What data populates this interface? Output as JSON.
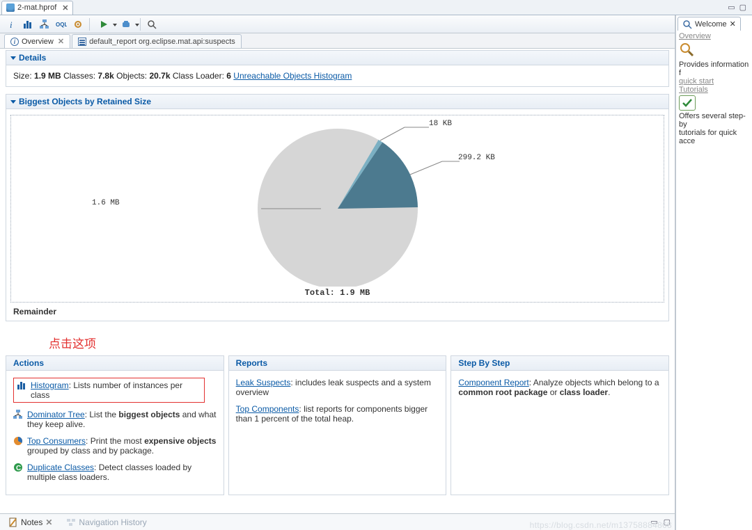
{
  "topTab": {
    "title": "2-mat.hprof"
  },
  "winbtns": {
    "min": "▭",
    "max": "▢"
  },
  "subtabs": {
    "overview": "Overview",
    "report": "default_report  org.eclipse.mat.api:suspects"
  },
  "toolbar": {
    "info": "info",
    "histogram": "histogram",
    "tree": "tree",
    "oql": "oql",
    "gear": "gear",
    "run": "run",
    "query": "query",
    "search": "search"
  },
  "details": {
    "heading": "Details",
    "sizeLabel": "Size:",
    "sizeValue": "1.9 MB",
    "classesLabel": "Classes:",
    "classesValue": "7.8k",
    "objectsLabel": "Objects:",
    "objectsValue": "20.7k",
    "clLabel": "Class Loader:",
    "clValue": "6",
    "unreachable": "Unreachable Objects Histogram"
  },
  "biggest": {
    "heading": "Biggest Objects by Retained Size",
    "remainder": "Remainder",
    "total_prefix": "Total: ",
    "total_value": "1.9 MB",
    "slice_a": "18 KB",
    "slice_b": "299.2 KB",
    "slice_c": "1.6 MB"
  },
  "chart_data": {
    "type": "pie",
    "title": "Biggest Objects by Retained Size",
    "slices": [
      {
        "label": "1.6 MB",
        "value": 1600,
        "color": "#d6d6d6"
      },
      {
        "label": "299.2 KB",
        "value": 299.2,
        "color": "#4c7a8f"
      },
      {
        "label": "18 KB",
        "value": 18,
        "color": "#7bb0c3"
      }
    ],
    "total_label": "Total: 1.9 MB"
  },
  "annot": "点击这项",
  "panels": {
    "actions": {
      "heading": "Actions",
      "histogram_link": "Histogram",
      "histogram_rest": ": Lists number of instances per class",
      "dominator_link": "Dominator Tree",
      "dominator_rest_a": ": List the ",
      "dominator_bold": "biggest objects",
      "dominator_rest_b": " and what they keep alive.",
      "topcons_link": "Top Consumers",
      "topcons_rest_a": ": Print the most ",
      "topcons_bold": "expensive objects",
      "topcons_rest_b": " grouped by class and by package.",
      "dup_link": "Duplicate Classes",
      "dup_rest": ": Detect classes loaded by multiple class loaders."
    },
    "reports": {
      "heading": "Reports",
      "leak_link": "Leak Suspects",
      "leak_rest": ": includes leak suspects and a system overview",
      "topc_link": "Top Components",
      "topc_rest": ": list reports for components bigger than 1 percent of the total heap."
    },
    "step": {
      "heading": "Step By Step",
      "comp_link": "Component Report",
      "comp_rest_a": ": Analyze objects which belong to a ",
      "comp_bold1": "common root package",
      "comp_mid": " or ",
      "comp_bold2": "class loader",
      "comp_end": "."
    }
  },
  "bottom": {
    "notes": "Notes",
    "nav": "Navigation History"
  },
  "right": {
    "tab": "Welcome",
    "overview": "Overview",
    "desc1": "Provides information f",
    "quick": "quick start",
    "tutorials": "Tutorials",
    "desc2a": "Offers several step-by",
    "desc2b": "tutorials for quick acce"
  },
  "watermark": "https://blog.csdn.net/m13758884868"
}
